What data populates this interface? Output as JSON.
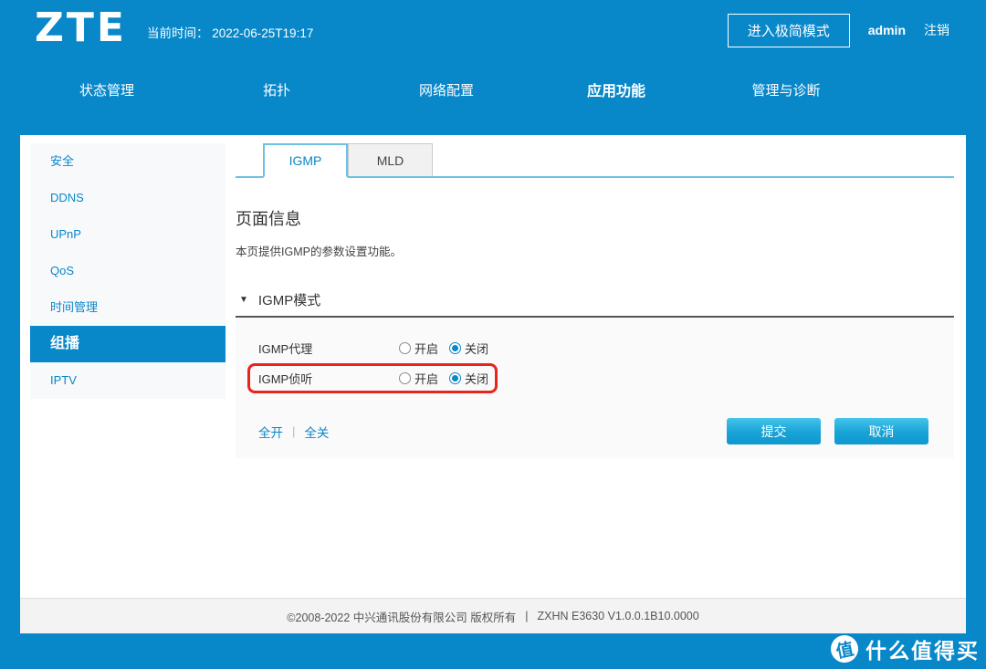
{
  "header": {
    "logo": "ZTE",
    "time_label": "当前时间：",
    "time_value": "2022-06-25T19:17",
    "simple_mode_button": "进入极简模式",
    "username": "admin",
    "logout_label": "注销"
  },
  "nav": {
    "items": [
      {
        "label": "状态管理",
        "active": false
      },
      {
        "label": "拓扑",
        "active": false
      },
      {
        "label": "网络配置",
        "active": false
      },
      {
        "label": "应用功能",
        "active": true
      },
      {
        "label": "管理与诊断",
        "active": false
      }
    ]
  },
  "sidebar": {
    "items": [
      {
        "label": "安全",
        "active": false
      },
      {
        "label": "DDNS",
        "active": false
      },
      {
        "label": "UPnP",
        "active": false
      },
      {
        "label": "QoS",
        "active": false
      },
      {
        "label": "时间管理",
        "active": false
      },
      {
        "label": "组播",
        "active": true
      },
      {
        "label": "IPTV",
        "active": false
      }
    ]
  },
  "tabs": {
    "items": [
      {
        "label": "IGMP",
        "active": true
      },
      {
        "label": "MLD",
        "active": false
      }
    ]
  },
  "main": {
    "page_info_title": "页面信息",
    "page_info_desc": "本页提供IGMP的参数设置功能。",
    "collapse_icon": "▼",
    "section_title": "IGMP模式",
    "rows": [
      {
        "label": "IGMP代理",
        "highlighted": false,
        "options": [
          {
            "label": "开启",
            "selected": false
          },
          {
            "label": "关闭",
            "selected": true
          }
        ]
      },
      {
        "label": "IGMP侦听",
        "highlighted": true,
        "options": [
          {
            "label": "开启",
            "selected": false
          },
          {
            "label": "关闭",
            "selected": true
          }
        ]
      }
    ],
    "links": {
      "all_on": "全开",
      "separator": "|",
      "all_off": "全关"
    },
    "buttons": {
      "submit": "提交",
      "cancel": "取消"
    }
  },
  "footer": {
    "copyright": "©2008-2022 中兴通讯股份有限公司 版权所有",
    "separator": "|",
    "version": "ZXHN E3630 V1.0.0.1B10.0000"
  },
  "watermark": {
    "badge": "值",
    "text": "什么值得买"
  },
  "colors": {
    "primary_blue": "#0887c9",
    "tab_border_blue": "#6ec0e4",
    "annotation_red": "#e8251d",
    "button_gradient_top": "#45c3ea",
    "button_gradient_bottom": "#0f98cd",
    "panel_gray": "#fafafa"
  }
}
